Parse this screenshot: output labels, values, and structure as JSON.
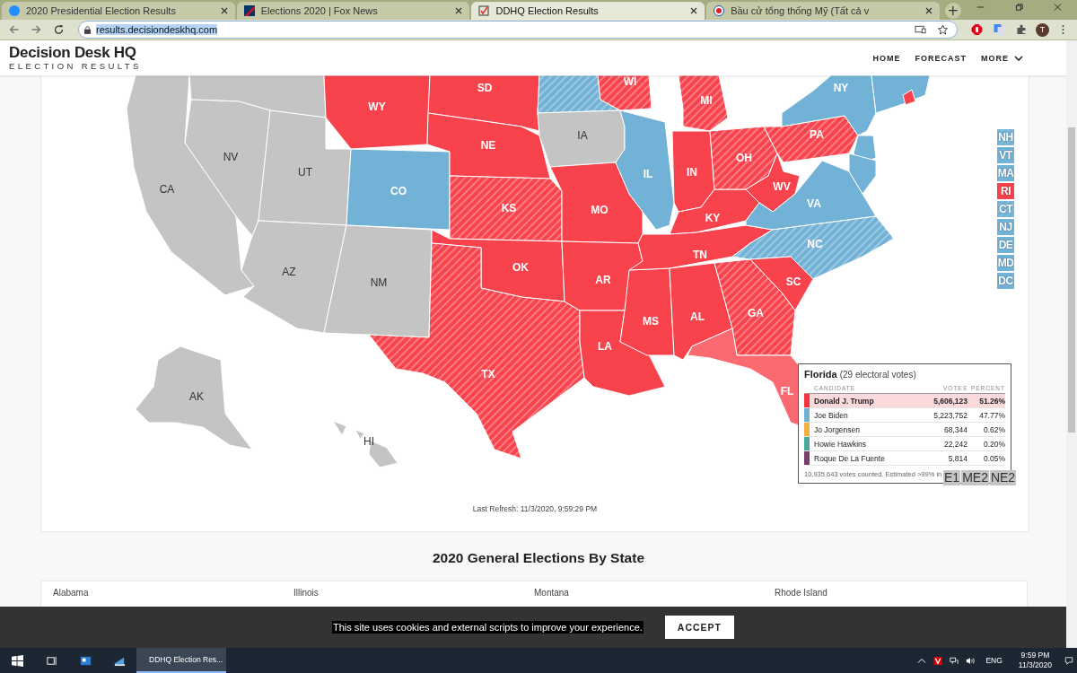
{
  "browser": {
    "tabs": [
      {
        "title": "2020 Presidential Election Results",
        "kind": "dot",
        "selected": false
      },
      {
        "title": "Elections 2020 | Fox News",
        "kind": "flag",
        "selected": false
      },
      {
        "title": "DDHQ Election Results",
        "kind": "ddhq",
        "selected": true
      },
      {
        "title": "Bầu cử tổng thống Mỹ (Tất cả v",
        "kind": "globe",
        "selected": false
      }
    ],
    "new_tab": "+",
    "address": "results.decisiondeskhq.com",
    "avatar": "T"
  },
  "site": {
    "logo_title": "Decision Desk HQ",
    "logo_subtitle": "ELECTION RESULTS",
    "nav": [
      {
        "label": "HOME",
        "dropdown": false
      },
      {
        "label": "FORECAST",
        "dropdown": false
      },
      {
        "label": "MORE",
        "dropdown": true
      }
    ]
  },
  "map": {
    "states": [
      {
        "label": "CA",
        "kind": "none",
        "called": true,
        "hovered": false
      },
      {
        "kind": "none",
        "called": true,
        "hovered": false
      },
      {
        "label": "NV",
        "kind": "none",
        "called": true,
        "hovered": false
      },
      {
        "label": "UT",
        "kind": "none",
        "called": true,
        "hovered": false
      },
      {
        "label": "AZ",
        "kind": "none",
        "called": true,
        "hovered": false
      },
      {
        "label": "CO",
        "kind": "dem",
        "called": true,
        "hovered": false
      },
      {
        "label": "NM",
        "kind": "none",
        "called": true,
        "hovered": false
      },
      {
        "label": "WY",
        "kind": "rep",
        "called": true,
        "hovered": false
      },
      {
        "label": "SD",
        "kind": "rep",
        "called": true,
        "hovered": false
      },
      {
        "label": "NE",
        "kind": "rep",
        "called": true,
        "hovered": false
      },
      {
        "label": "KS",
        "kind": "rep",
        "called": false,
        "hovered": false
      },
      {
        "label": "OK",
        "kind": "rep",
        "called": true,
        "hovered": false
      },
      {
        "label": "TX",
        "kind": "rep",
        "called": false,
        "hovered": false
      },
      {
        "kind": "dem",
        "called": false,
        "hovered": false
      },
      {
        "label": "IA",
        "kind": "none",
        "called": true,
        "hovered": false
      },
      {
        "label": "MO",
        "kind": "rep",
        "called": true,
        "hovered": false
      },
      {
        "label": "AR",
        "kind": "rep",
        "called": true,
        "hovered": false
      },
      {
        "label": "LA",
        "kind": "rep",
        "called": true,
        "hovered": false
      },
      {
        "label": "WI",
        "kind": "rep",
        "called": false,
        "hovered": false
      },
      {
        "label": "IL",
        "kind": "dem",
        "called": true,
        "hovered": false
      },
      {
        "label": "MS",
        "kind": "rep",
        "called": true,
        "hovered": false
      },
      {
        "label": "MI",
        "kind": "rep",
        "called": false,
        "hovered": false
      },
      {
        "label": "IN",
        "kind": "rep",
        "called": true,
        "hovered": false
      },
      {
        "label": "KY",
        "kind": "rep",
        "called": true,
        "hovered": false
      },
      {
        "label": "TN",
        "kind": "rep",
        "called": true,
        "hovered": false
      },
      {
        "label": "AL",
        "kind": "rep",
        "called": true,
        "hovered": false
      },
      {
        "label": "OH",
        "kind": "rep",
        "called": false,
        "hovered": false
      },
      {
        "label": "GA",
        "kind": "rep",
        "called": false,
        "hovered": false
      },
      {
        "label": "FL",
        "kind": "rep",
        "called": true,
        "hovered": true
      },
      {
        "label": "WV",
        "kind": "rep",
        "called": true,
        "hovered": false
      },
      {
        "label": "PA",
        "kind": "rep",
        "called": false,
        "hovered": false
      },
      {
        "label": "VA",
        "kind": "dem",
        "called": true,
        "hovered": false
      },
      {
        "label": "NC",
        "kind": "dem",
        "called": false,
        "hovered": false
      },
      {
        "label": "SC",
        "kind": "rep",
        "called": true,
        "hovered": false
      },
      {
        "label": "NY",
        "kind": "dem",
        "called": true,
        "hovered": false
      },
      {
        "kind": "dem",
        "called": true,
        "hovered": false
      },
      {
        "kind": "dem",
        "called": true,
        "hovered": false
      },
      {
        "kind": "dem",
        "called": true,
        "hovered": false
      },
      {
        "kind": "rep",
        "called": true,
        "hovered": false
      },
      {
        "label": "AK",
        "kind": "none",
        "called": true,
        "hovered": false
      },
      {
        "label": "HI",
        "kind": "none",
        "called": true,
        "hovered": false
      }
    ],
    "small_states": [
      {
        "label": "NH",
        "kind": "dem",
        "called": false
      },
      {
        "label": "VT",
        "kind": "dem",
        "called": true
      },
      {
        "label": "MA",
        "kind": "dem",
        "called": true
      },
      {
        "label": "RI",
        "kind": "rep",
        "called": true
      },
      {
        "label": "CT",
        "kind": "dem",
        "called": false
      },
      {
        "label": "NJ",
        "kind": "dem",
        "called": true
      },
      {
        "label": "DE",
        "kind": "dem",
        "called": true
      },
      {
        "label": "MD",
        "kind": "dem",
        "called": true
      },
      {
        "label": "DC",
        "kind": "dem",
        "called": true
      }
    ],
    "districts": [
      "E1",
      "ME2",
      "NE2"
    ],
    "tooltip": {
      "state": "Florida",
      "subtitle": "(29 electoral votes)",
      "columns": [
        "CANDIDATE",
        "VOTES",
        "PERCENT"
      ],
      "rows": [
        {
          "name": "Donald J. Trump",
          "votes": "5,606,123",
          "percent": "51.26%",
          "color": "#f5333f",
          "leading": true
        },
        {
          "name": "Joe Biden",
          "votes": "5,223,752",
          "percent": "47.77%",
          "color": "#6fb1d5",
          "leading": false
        },
        {
          "name": "Jo Jorgensen",
          "votes": "68,344",
          "percent": "0.62%",
          "color": "#f5b041",
          "leading": false
        },
        {
          "name": "Howie Hawkins",
          "votes": "22,242",
          "percent": "0.20%",
          "color": "#4aa89a",
          "leading": false
        },
        {
          "name": "Roque De La Fuente",
          "votes": "5,814",
          "percent": "0.05%",
          "color": "#7b3f6e",
          "leading": false
        }
      ],
      "footer": "10,935,643 votes counted. Estimated >99% in"
    },
    "last_refresh": "Last Refresh: 11/3/2020, 9:59:29 PM"
  },
  "section_heading": "2020 General Elections By State",
  "state_list": [
    "Alabama",
    "Illinois",
    "Montana",
    "Rhode Island"
  ],
  "cookie": {
    "text": "This site uses cookies and external scripts to improve your experience.",
    "button": "ACCEPT"
  },
  "taskbar": {
    "app": "DDHQ Election Res...",
    "language": "ENG",
    "time": "9:59 PM",
    "date": "11/3/2020"
  }
}
